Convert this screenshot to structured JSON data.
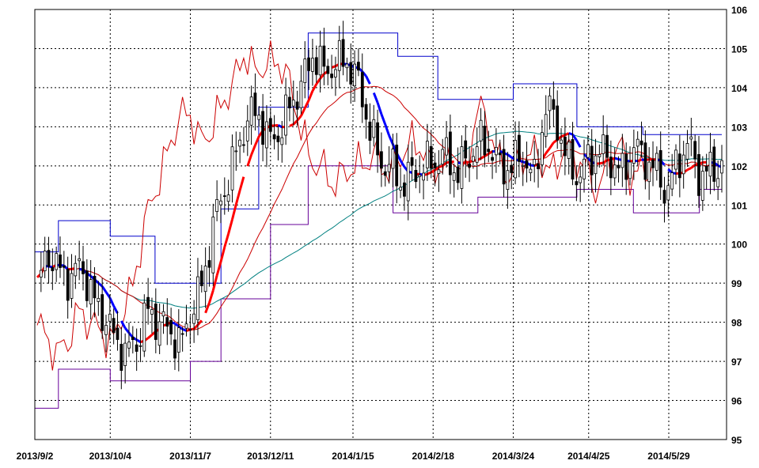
{
  "chart_data": {
    "type": "candlestick",
    "title": "",
    "xlabel": "",
    "ylabel": "",
    "ylim": [
      95,
      106
    ],
    "grid": true,
    "y_ticks": [
      "95",
      "96",
      "97",
      "98",
      "99",
      "100",
      "101",
      "102",
      "103",
      "104",
      "105",
      "106"
    ],
    "x_ticks": [
      "2013/9/2",
      "2013/10/4",
      "2013/11/7",
      "2013/12/11",
      "2014/1/15",
      "2014/2/18",
      "2014/3/24",
      "2014/4/25",
      "2014/5/29"
    ],
    "colors": {
      "background": "#ffffff",
      "candle_up": "#ffffff",
      "candle_down": "#000000",
      "ma_red_thick": "#ff0000",
      "ma_blue_thick": "#0000ff",
      "ma_red_thin": "#cc0000",
      "ma_green": "#008080",
      "channel_high": "#0000cc",
      "channel_low": "#660099",
      "lagging_line": "#cc0000"
    },
    "closes": [
      98.9,
      99.8,
      99.3,
      99.1,
      99.5,
      98.6,
      98.2,
      97.6,
      97.2,
      97.5,
      98.3,
      98.0,
      97.8,
      97.4,
      98.3,
      99.0,
      100.6,
      101.4,
      102.3,
      103.2,
      103.4,
      102.6,
      102.9,
      103.6,
      104.1,
      104.9,
      104.4,
      104.6,
      104.7,
      104.2,
      103.1,
      102.1,
      102.0,
      101.5,
      101.8,
      102.0,
      102.1,
      102.3,
      101.8,
      102.2,
      102.6,
      102.5,
      101.9,
      102.0,
      102.3,
      101.6,
      103.5,
      103.2,
      102.1,
      101.7,
      102.2,
      102.4,
      102.1,
      101.8,
      102.5,
      102.2,
      101.9,
      101.3,
      102.1,
      102.6,
      101.7,
      101.9,
      102.0
    ],
    "resistance": [
      {
        "date": "2013/9/2",
        "value": 99.8
      },
      {
        "date": "2013/9/12",
        "value": 100.6
      },
      {
        "date": "2013/10/4",
        "value": 100.2
      },
      {
        "date": "2013/10/23",
        "value": 99.0
      },
      {
        "date": "2013/11/20",
        "value": 100.9
      },
      {
        "date": "2013/12/6",
        "value": 103.5
      },
      {
        "date": "2013/12/27",
        "value": 105.4
      },
      {
        "date": "2014/2/3",
        "value": 104.8
      },
      {
        "date": "2014/2/20",
        "value": 103.7
      },
      {
        "date": "2014/3/24",
        "value": 104.1
      },
      {
        "date": "2014/4/20",
        "value": 103.0
      },
      {
        "date": "2014/5/18",
        "value": 102.8
      }
    ],
    "support": [
      {
        "date": "2013/9/2",
        "value": 95.8
      },
      {
        "date": "2013/9/12",
        "value": 96.8
      },
      {
        "date": "2013/10/4",
        "value": 96.5
      },
      {
        "date": "2013/11/7",
        "value": 97.0
      },
      {
        "date": "2013/11/20",
        "value": 98.6
      },
      {
        "date": "2013/12/11",
        "value": 100.5
      },
      {
        "date": "2013/12/27",
        "value": 102.0
      },
      {
        "date": "2014/2/1",
        "value": 100.8
      },
      {
        "date": "2014/3/9",
        "value": 101.2
      },
      {
        "date": "2014/4/20",
        "value": 101.4
      },
      {
        "date": "2014/5/14",
        "value": 100.8
      },
      {
        "date": "2014/6/11",
        "value": 101.4
      }
    ]
  }
}
